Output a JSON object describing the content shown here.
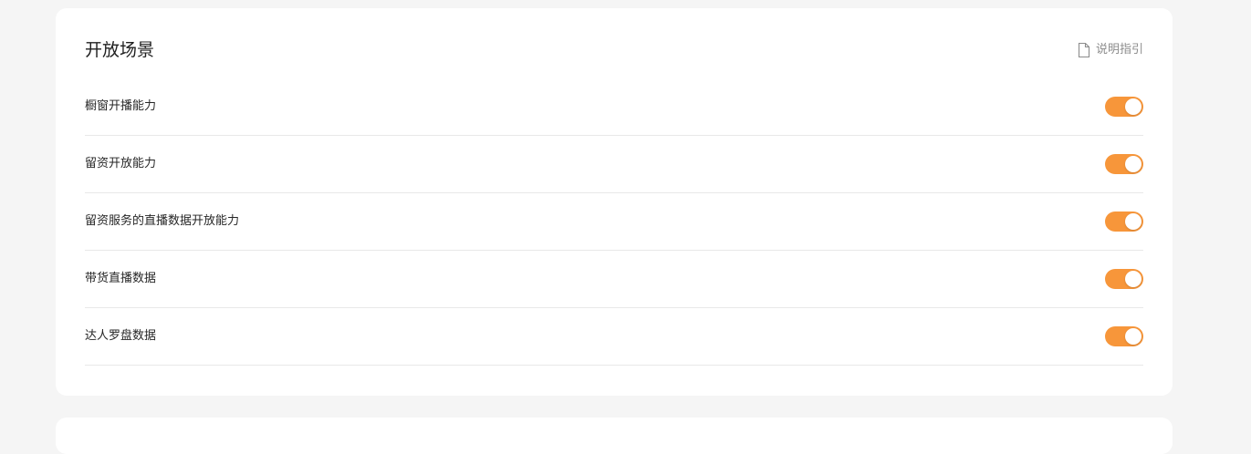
{
  "section": {
    "title": "开放场景",
    "guide_label": "说明指引",
    "guide_icon": "document-icon"
  },
  "colors": {
    "switch_on": "#f7963a",
    "background": "#f5f5f5",
    "card": "#ffffff"
  },
  "items": [
    {
      "label": "橱窗开播能力",
      "enabled": true
    },
    {
      "label": "留资开放能力",
      "enabled": true
    },
    {
      "label": "留资服务的直播数据开放能力",
      "enabled": true
    },
    {
      "label": "带货直播数据",
      "enabled": true
    },
    {
      "label": "达人罗盘数据",
      "enabled": true
    }
  ]
}
